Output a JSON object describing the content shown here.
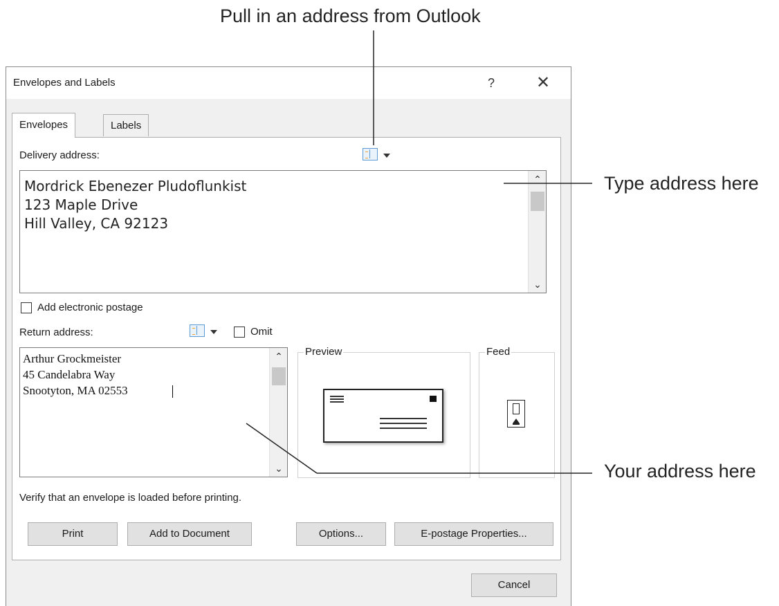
{
  "callouts": {
    "outlook": "Pull in an address from Outlook",
    "type_address": "Type address here",
    "your_address": "Your address here"
  },
  "dialog": {
    "title": "Envelopes and Labels",
    "help": "?",
    "close": "✕"
  },
  "tabs": [
    {
      "label": "Envelopes",
      "selected": true
    },
    {
      "label": "Labels",
      "selected": false
    }
  ],
  "delivery": {
    "label": "Delivery address:",
    "lines": [
      "Mordrick Ebenezer Pludoflunkist",
      "123 Maple Drive",
      "Hill Valley, CA 92123"
    ]
  },
  "postage": {
    "label": "Add electronic postage",
    "checked": false
  },
  "return_address": {
    "label": "Return address:",
    "omit_label": "Omit",
    "omit_checked": false,
    "lines": [
      "Arthur Grockmeister",
      "45 Candelabra Way",
      "Snootyton, MA 02553"
    ]
  },
  "preview": {
    "label": "Preview"
  },
  "feed": {
    "label": "Feed"
  },
  "verify_text": "Verify that an envelope is loaded before printing.",
  "buttons": {
    "print": "Print",
    "add_to_document": "Add to Document",
    "options": "Options...",
    "epostage": "E-postage Properties...",
    "cancel": "Cancel"
  },
  "icons": {
    "address_book": "address-book-icon",
    "dropdown": "chevron-down-icon",
    "scroll_up": "▲",
    "scroll_down": "▼"
  },
  "colors": {
    "dialog_bg": "#f0f0f0",
    "panel_bg": "#ffffff",
    "button_bg": "#e1e1e1",
    "icon_blue": "#5b9bd5"
  }
}
